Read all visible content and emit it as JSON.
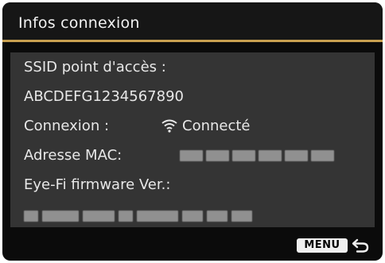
{
  "header": {
    "title": "Infos connexion"
  },
  "info": {
    "ssid_label": "SSID point d'accès :",
    "ssid_value": "ABCDEFG1234567890",
    "connection_label": "Connexion :",
    "connection_status": "Connecté",
    "connection_icon": "wifi-icon",
    "mac_label": "Adresse MAC:",
    "firmware_label": "Eye-Fi firmware Ver.:"
  },
  "footer": {
    "menu_label": "MENU",
    "return_icon": "return-arrow-icon"
  },
  "colors": {
    "background": "#0b0b0b",
    "panel": "#343434",
    "accent_line": "#c8a050",
    "text": "#e8e8e8"
  }
}
